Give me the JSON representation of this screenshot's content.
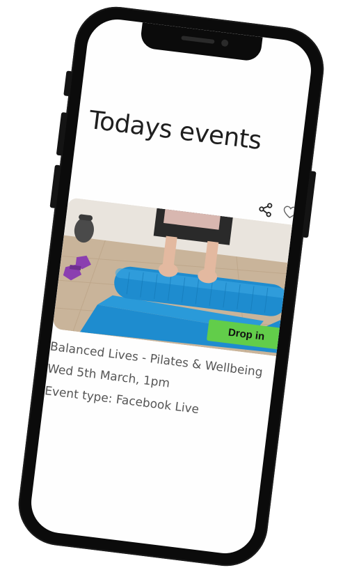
{
  "page": {
    "title": "Todays events"
  },
  "event": {
    "title": "Balanced Lives - Pilates & Wellbeing",
    "date": "Wed 5th March, 1pm",
    "type": "Event type: Facebook Live",
    "badge": "Drop in",
    "actions": {
      "share_icon": "share-icon",
      "favorite_icon": "heart-outline-icon"
    }
  },
  "colors": {
    "badge_bg": "#62cd4a",
    "mat_blue": "#1e8ccf",
    "weight_purple": "#8b3fb0",
    "phone_frame": "#0b0b0b",
    "floor": "#c9b49a"
  }
}
